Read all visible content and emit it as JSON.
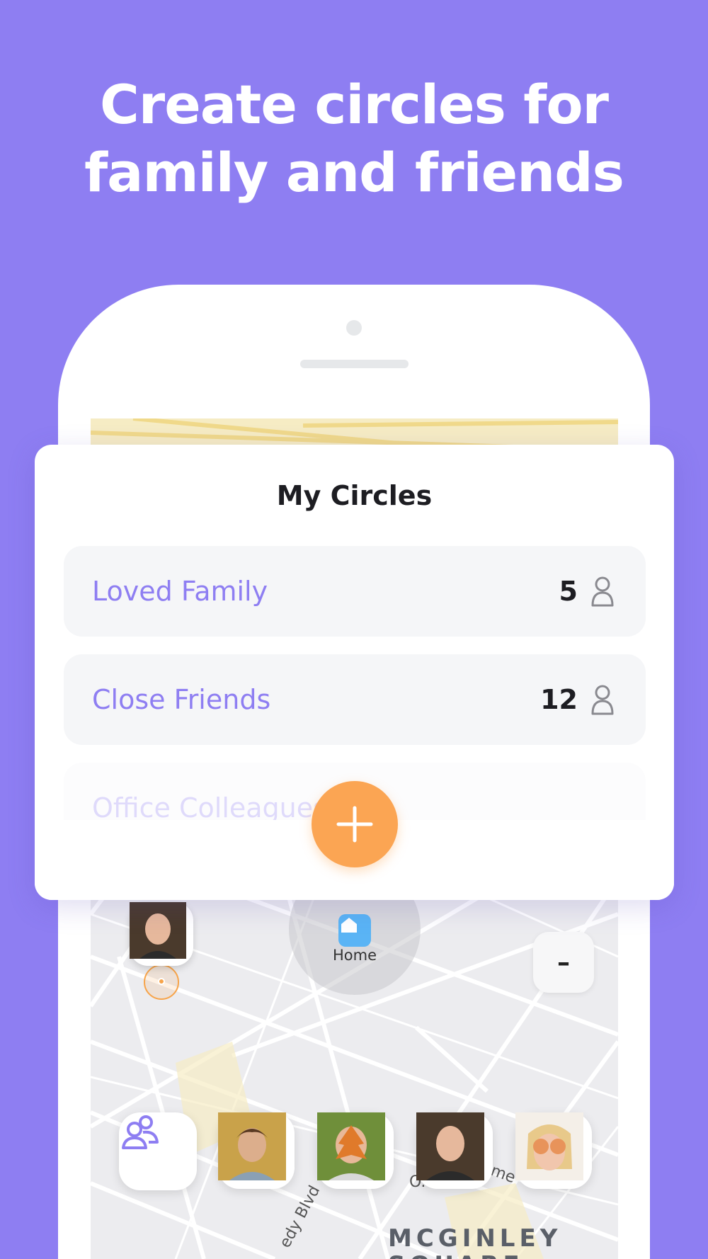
{
  "headline": {
    "line1": "Create circles for",
    "line2": "family and friends"
  },
  "map": {
    "home_label": "Home",
    "zoom_out_label": "–",
    "zoom_in_label": "+",
    "area_label": "MCGINLEY",
    "area_label_2": "SQUARE",
    "street_label": "edy Blvd",
    "street_label_2": "me",
    "place_label": "O."
  },
  "circles_panel": {
    "title": "My Circles",
    "items": [
      {
        "name": "Loved Family",
        "count": "5"
      },
      {
        "name": "Close Friends",
        "count": "12"
      },
      {
        "name": "Office Colleagues",
        "count": ""
      }
    ],
    "add_button": "add-circle"
  },
  "bottom_bar": {
    "circles_icon": "group-icon",
    "members": [
      "member-1",
      "member-2",
      "member-3",
      "member-4"
    ]
  },
  "colors": {
    "background": "#8e7ef2",
    "accent": "#8e7ef2",
    "add_button": "#fba553",
    "home_pin": "#5ab4f5"
  }
}
